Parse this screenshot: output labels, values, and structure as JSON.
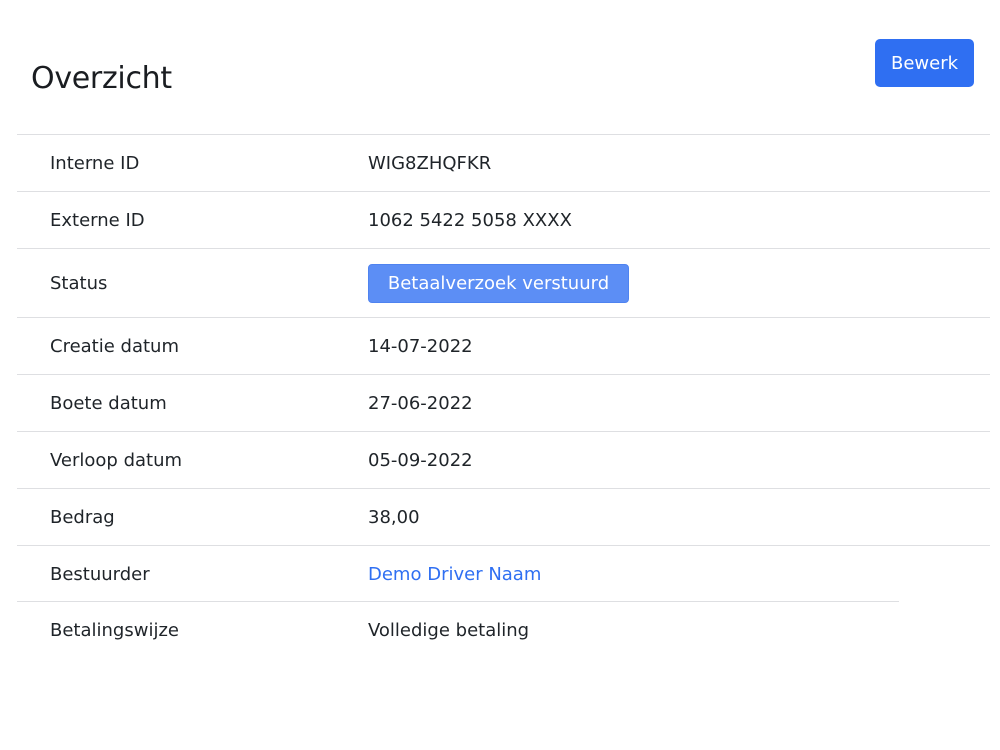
{
  "colors": {
    "primary": "#2f6ff2",
    "status_badge": "#5c8ef5",
    "link": "#2f6ff2",
    "divider": "#dedfe2"
  },
  "header": {
    "title": "Overzicht",
    "edit_label": "Bewerk"
  },
  "details": {
    "internal_id": {
      "label": "Interne ID",
      "value": "WIG8ZHQFKR"
    },
    "external_id": {
      "label": "Externe ID",
      "value": "1062 5422 5058 XXXX"
    },
    "status": {
      "label": "Status",
      "value": "Betaalverzoek verstuurd"
    },
    "creation_date": {
      "label": "Creatie datum",
      "value": "14-07-2022"
    },
    "fine_date": {
      "label": "Boete datum",
      "value": "27-06-2022"
    },
    "expiry_date": {
      "label": "Verloop datum",
      "value": "05-09-2022"
    },
    "amount": {
      "label": "Bedrag",
      "value": "38,00"
    },
    "driver": {
      "label": "Bestuurder",
      "value": "Demo Driver Naam"
    },
    "payment_method": {
      "label": "Betalingswijze",
      "value": "Volledige betaling"
    }
  }
}
